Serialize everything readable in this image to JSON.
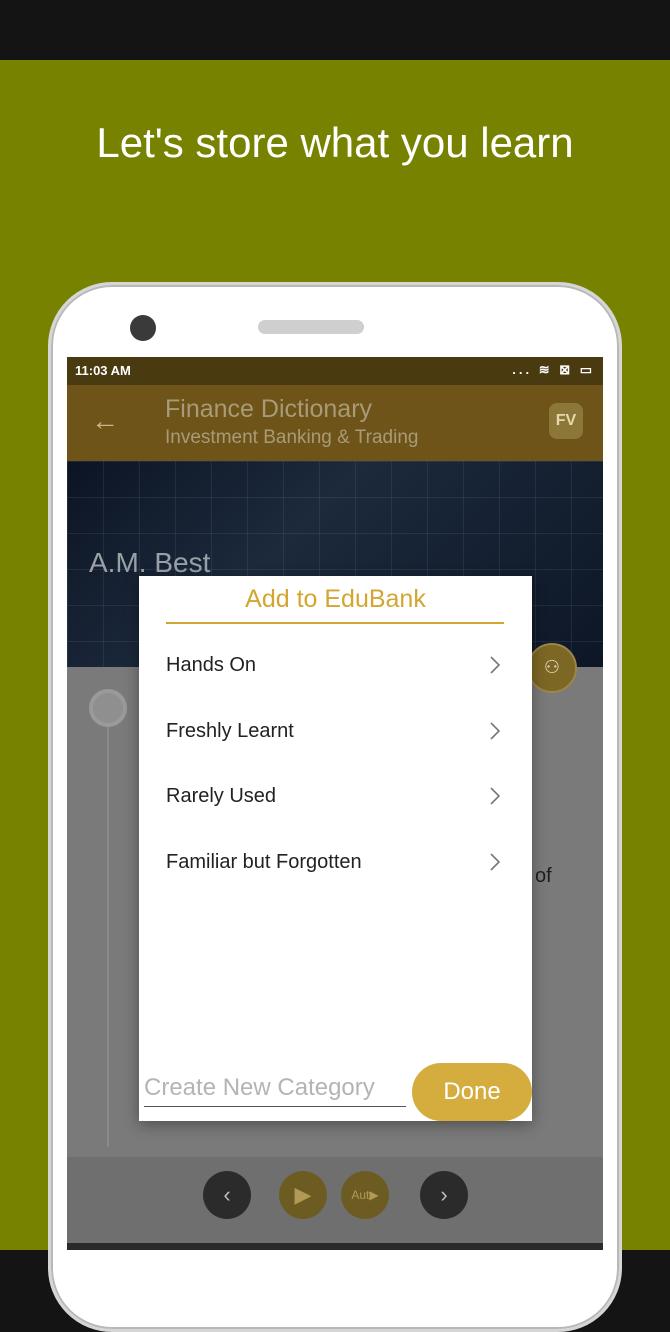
{
  "headline": "Let's store what you learn",
  "status": {
    "time": "11:03 AM",
    "icons": "... ≋ ⊠ ▭"
  },
  "appbar": {
    "title": "Finance Dictionary",
    "subtitle": "Investment Banking & Trading",
    "logo": "FV",
    "icons": {
      "back": "arrow-left-icon",
      "logo": "app-logo-icon"
    }
  },
  "hero": {
    "term": "A.M. Best"
  },
  "content": {
    "fragment": "of"
  },
  "player": {
    "prev": "‹",
    "play": "▶",
    "auto": "Aut▶",
    "next": "›"
  },
  "dialog": {
    "title": "Add to EduBank",
    "items": [
      {
        "label": "Hands On"
      },
      {
        "label": "Freshly Learnt"
      },
      {
        "label": "Rarely Used"
      },
      {
        "label": "Familiar but Forgotten"
      }
    ],
    "new_category_placeholder": "Create New Category",
    "done_label": "Done"
  },
  "colors": {
    "accent": "#d5ad3f",
    "banner": "#778300",
    "appbar": "#6e5418"
  }
}
